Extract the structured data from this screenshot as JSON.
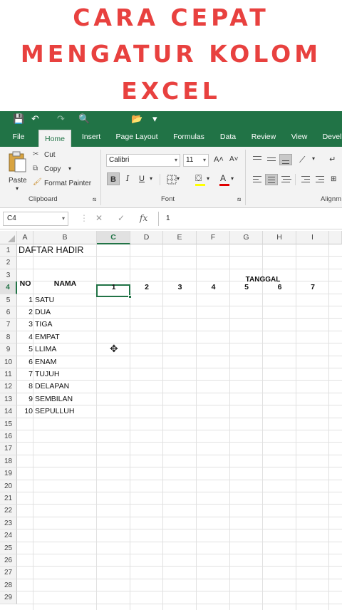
{
  "headline": {
    "line1": "CARA CEPAT",
    "line2": "MENGATUR KOLOM",
    "line3": "EXCEL"
  },
  "qat": {
    "save": "💾",
    "undo": "↶",
    "redo": "↷",
    "print_preview": "🔍",
    "open": "📂",
    "customize": "▾"
  },
  "tabs": [
    "File",
    "Home",
    "Insert",
    "Page Layout",
    "Formulas",
    "Data",
    "Review",
    "View",
    "Devel"
  ],
  "ribbon": {
    "clipboard": {
      "paste": "Paste",
      "cut": "Cut",
      "copy": "Copy",
      "format_painter": "Format Painter",
      "label": "Clipboard"
    },
    "font": {
      "name": "Calibri",
      "size": "11",
      "bold": "B",
      "italic": "I",
      "underline": "U",
      "grow": "A˄",
      "shrink": "A˅",
      "label": "Font"
    },
    "alignment": {
      "label": "Alignm"
    }
  },
  "formula_bar": {
    "name_box": "C4",
    "cancel": "✕",
    "enter": "✓",
    "fx": "fx",
    "value": "1"
  },
  "columns": [
    "A",
    "B",
    "C",
    "D",
    "E",
    "F",
    "G",
    "H",
    "I"
  ],
  "rows": [
    "1",
    "2",
    "3",
    "4",
    "5",
    "6",
    "7",
    "8",
    "9",
    "10",
    "11",
    "12",
    "13",
    "14",
    "15",
    "16",
    "17",
    "18",
    "19",
    "20",
    "21",
    "22",
    "23",
    "24",
    "25",
    "26",
    "27",
    "28",
    "29"
  ],
  "sheet": {
    "title": "DAFTAR HADIR",
    "no_header": "NO",
    "nama_header": "NAMA",
    "tanggal_header": "TANGGAL",
    "dates": [
      "1",
      "2",
      "3",
      "4",
      "5",
      "6",
      "7"
    ],
    "entries": [
      {
        "no": "1",
        "nama": "SATU"
      },
      {
        "no": "2",
        "nama": "DUA"
      },
      {
        "no": "3",
        "nama": "TIGA"
      },
      {
        "no": "4",
        "nama": "EMPAT"
      },
      {
        "no": "5",
        "nama": "LLIMA"
      },
      {
        "no": "6",
        "nama": "ENAM"
      },
      {
        "no": "7",
        "nama": "TUJUH"
      },
      {
        "no": "8",
        "nama": "DELAPAN"
      },
      {
        "no": "9",
        "nama": "SEMBILAN"
      },
      {
        "no": "10",
        "nama": "SEPULLUH"
      }
    ]
  },
  "colors": {
    "excel_green": "#217346",
    "headline_red": "#e8413f"
  }
}
